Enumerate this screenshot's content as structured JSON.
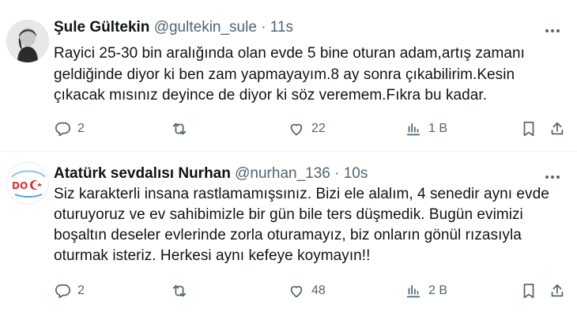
{
  "tweets": [
    {
      "display_name": "Şule Gültekin",
      "handle": "@gultekin_sule",
      "separator": "·",
      "time": "11s",
      "text": "Rayici 25-30 bin aralığında olan evde 5 bine oturan adam,artış zamanı geldiğinde diyor ki ben zam yapmayayım.8 ay sonra çıkabilirim.Kesin çıkacak mısınız deyince de diyor ki söz veremem.Fıkra bu kadar.",
      "replies": "2",
      "retweets": "",
      "likes": "22",
      "views": "1 B"
    },
    {
      "display_name": "Atatürk sevdalısı Nurhan",
      "handle": "@nurhan_136",
      "separator": "·",
      "time": "10s",
      "text": "Siz karakterli insana rastlamamışsınız. Bizi ele alalım, 4 senedir aynı evde oturuyoruz ve ev sahibimizle bir gün bile ters düşmedik. Bugün evimizi boşaltın deseler evlerinde zorla oturamayız, biz onların gönül rızasıyla oturmak isteriz. Herkesi aynı kefeye koymayın!!",
      "replies": "2",
      "retweets": "",
      "likes": "48",
      "views": "2 B"
    }
  ],
  "icons": {
    "reply": "reply-icon",
    "retweet": "retweet-icon",
    "like": "heart-icon",
    "views": "views-icon",
    "bookmark": "bookmark-icon",
    "share": "share-icon",
    "more": "more-icon"
  },
  "colors": {
    "text": "#0f1419",
    "secondary": "#536471",
    "divider": "#eff3f4",
    "background": "#ffffff"
  }
}
